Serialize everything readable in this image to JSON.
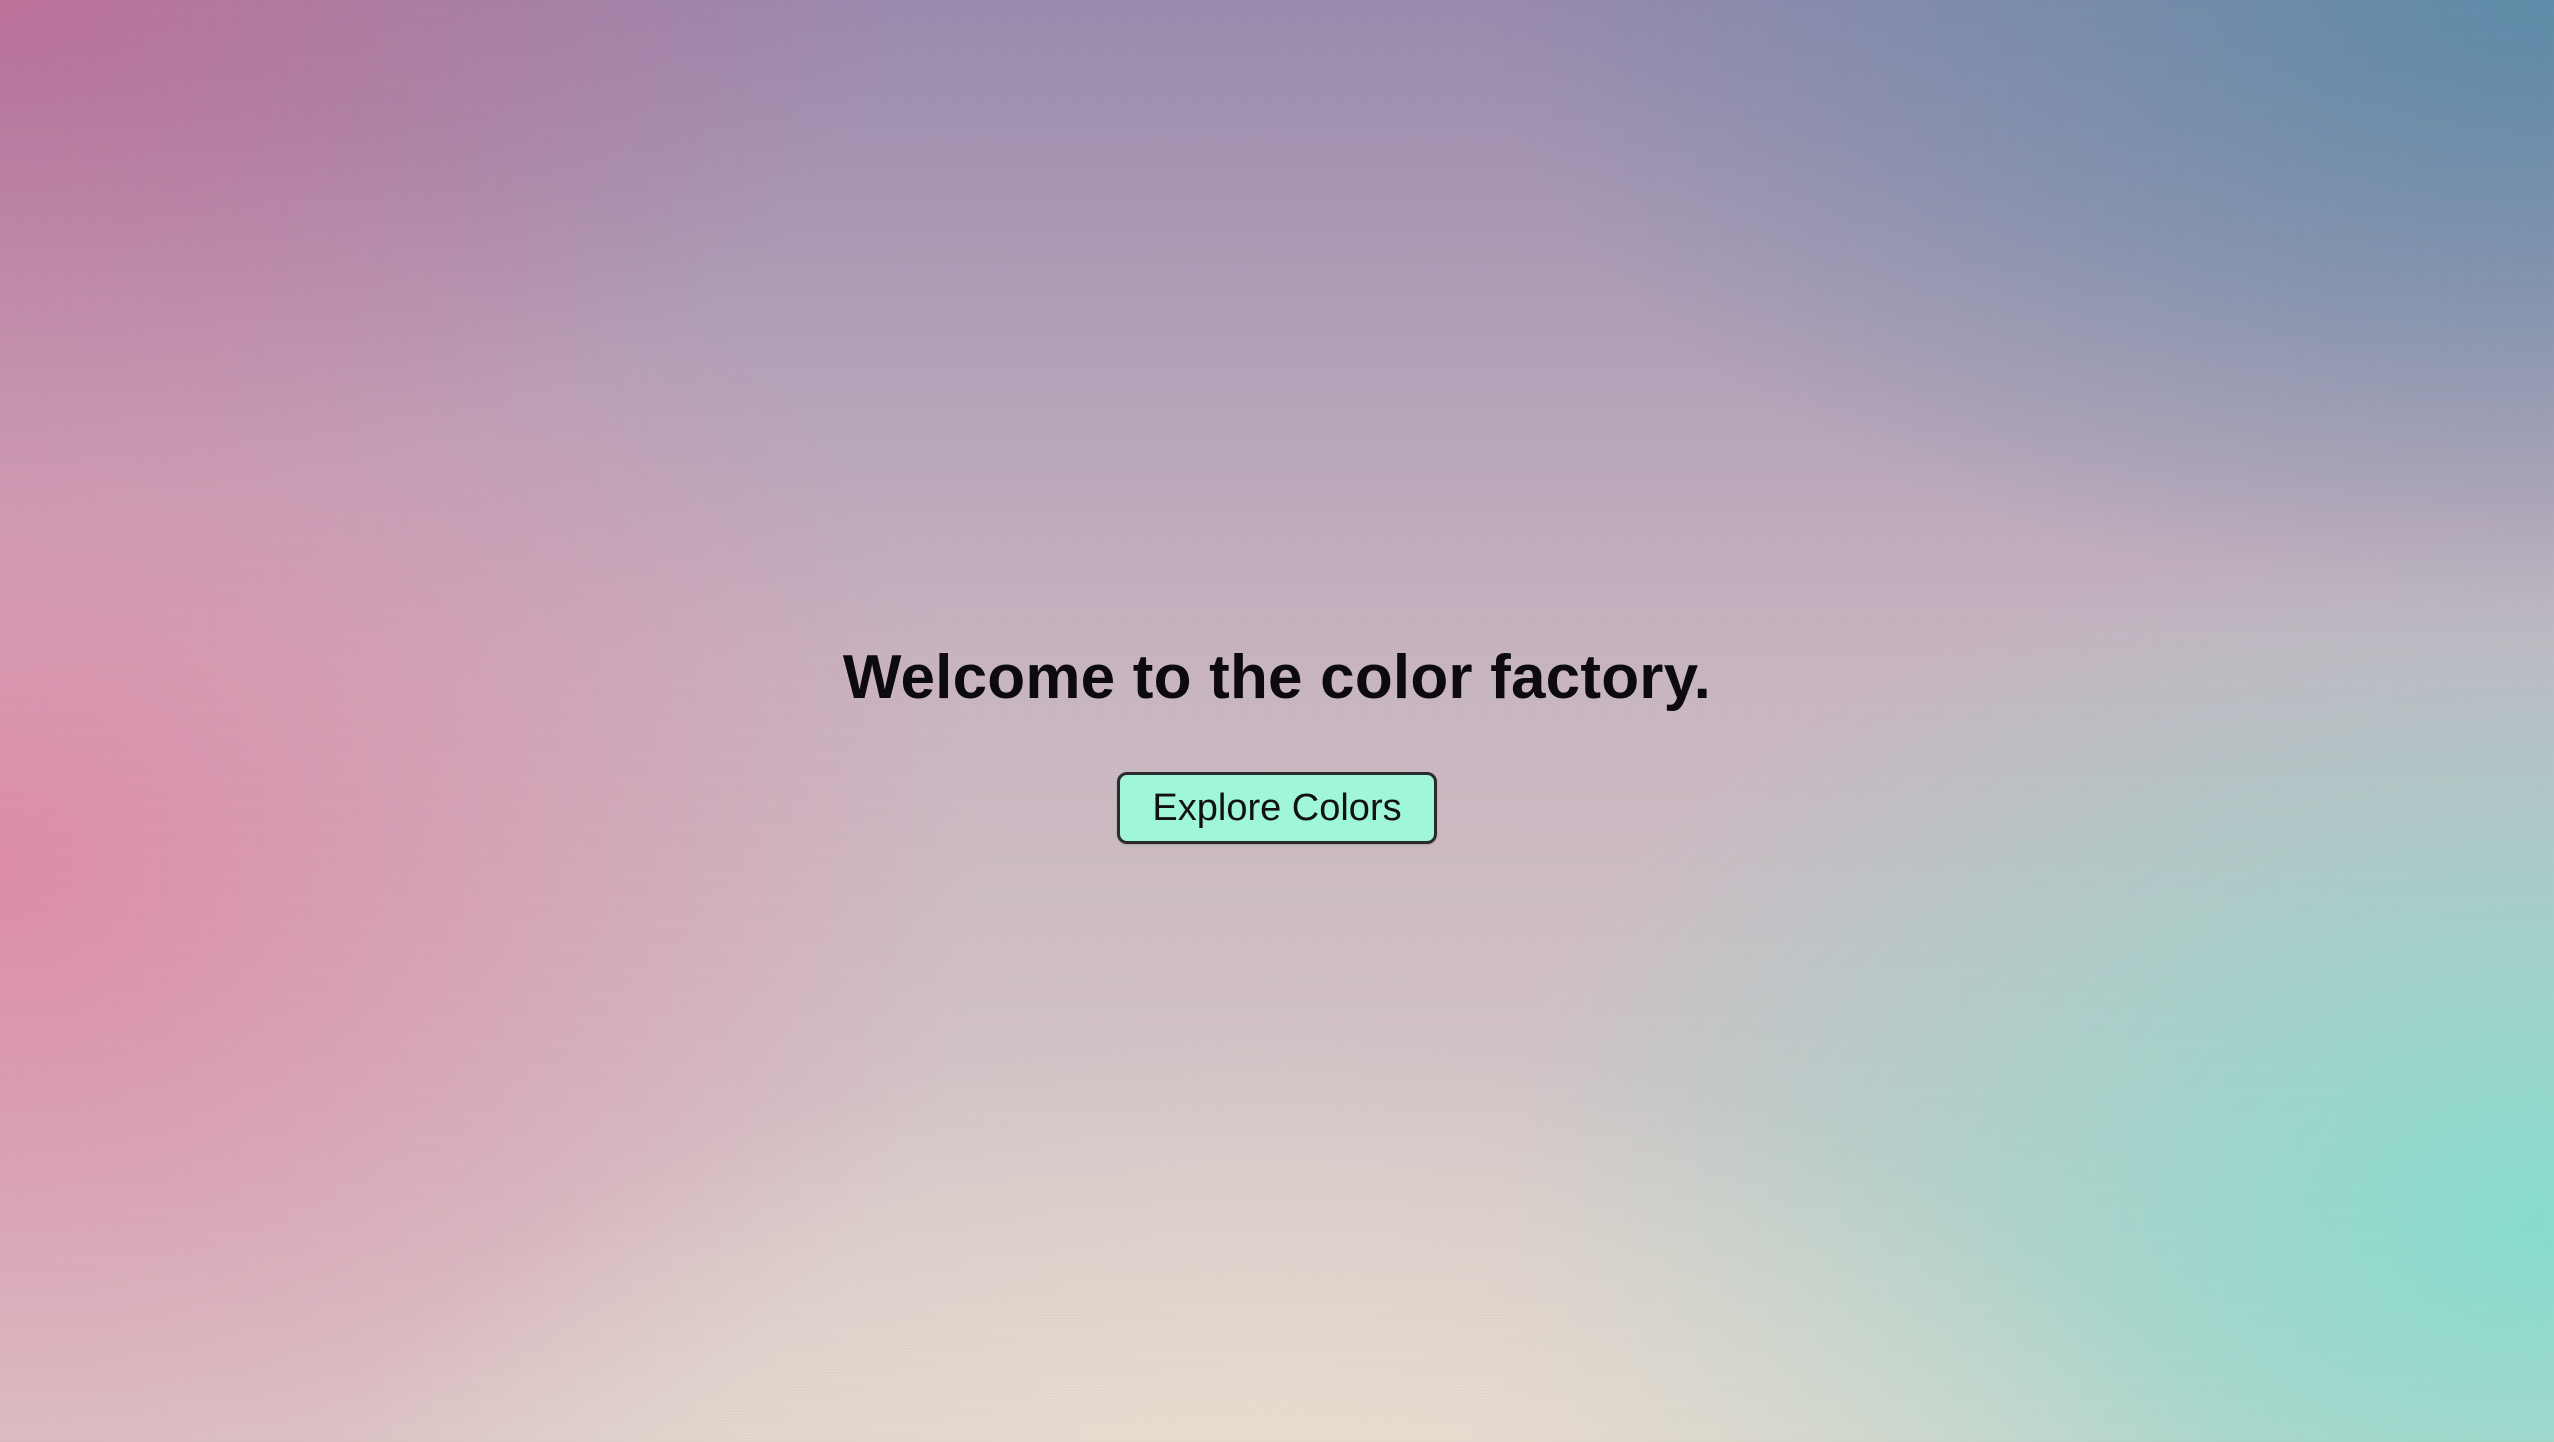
{
  "hero": {
    "title": "Welcome to the color factory.",
    "button_label": "Explore Colors"
  },
  "colors": {
    "button_background": "#9ff6da",
    "button_border": "#2b2b2b",
    "title_text": "#0c0a0c",
    "gradient_top_left": "#be7098",
    "gradient_top_right": "#5a8ca8",
    "gradient_left": "#de8aa8",
    "gradient_bottom_right": "#82dece",
    "gradient_bottom_center": "#eee2d2"
  }
}
